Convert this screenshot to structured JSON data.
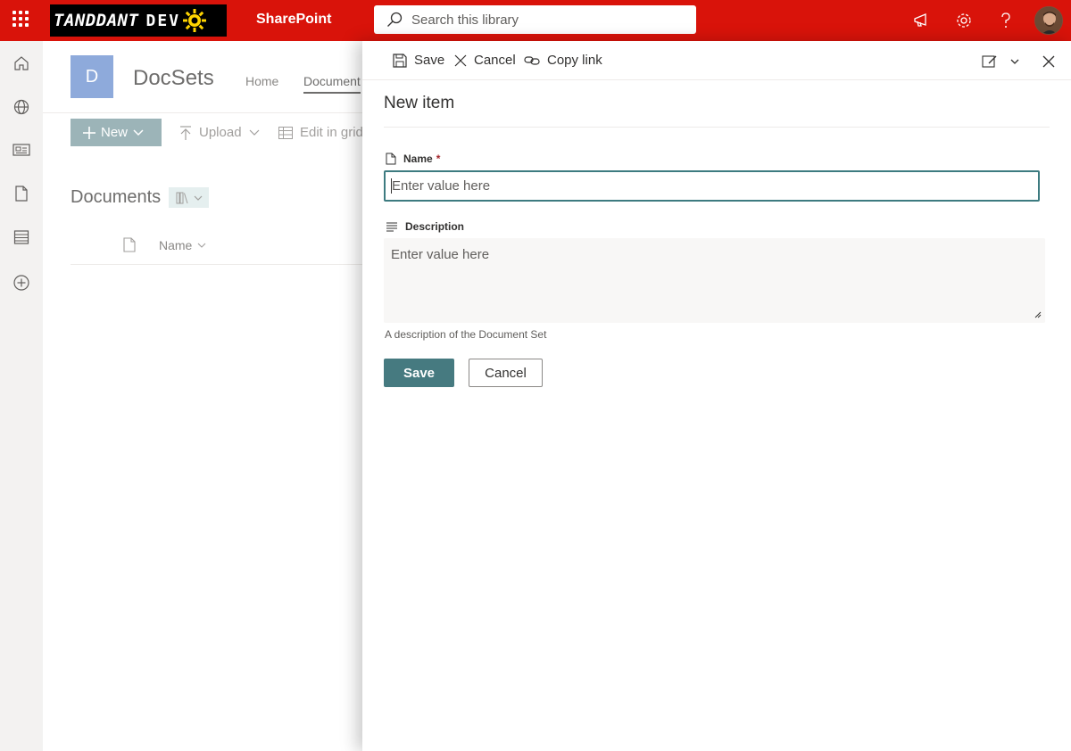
{
  "suite_bar": {
    "logo_brand": "TANDDANT",
    "logo_suffix": "DEV",
    "app_name": "SharePoint",
    "search_placeholder": "Search this library",
    "icons": [
      "waffle-icon",
      "megaphone-icon",
      "gear-icon",
      "help-icon",
      "avatar"
    ],
    "background_color": "#d9130a"
  },
  "left_rail": {
    "icons": [
      "home-icon",
      "globe-icon",
      "news-icon",
      "document-icon",
      "list-icon",
      "add-circle-icon"
    ]
  },
  "site": {
    "logo_letter": "D",
    "title": "DocSets",
    "nav": [
      {
        "label": "Home"
      },
      {
        "label": "Document"
      }
    ]
  },
  "commands": {
    "new_label": "New",
    "upload_label": "Upload",
    "edit_grid_label": "Edit in grid"
  },
  "library": {
    "title": "Documents",
    "column_name": "Name"
  },
  "panel": {
    "toolbar": {
      "save_label": "Save",
      "cancel_label": "Cancel",
      "copy_link_label": "Copy link"
    },
    "title": "New item",
    "fields": {
      "name": {
        "label": "Name",
        "required_marker": "*",
        "placeholder": "Enter value here",
        "value": ""
      },
      "description": {
        "label": "Description",
        "placeholder": "Enter value here",
        "value": "",
        "help_text": "A description of the Document Set"
      }
    },
    "save_button": "Save",
    "cancel_button": "Cancel",
    "accent_color": "#467a80"
  }
}
